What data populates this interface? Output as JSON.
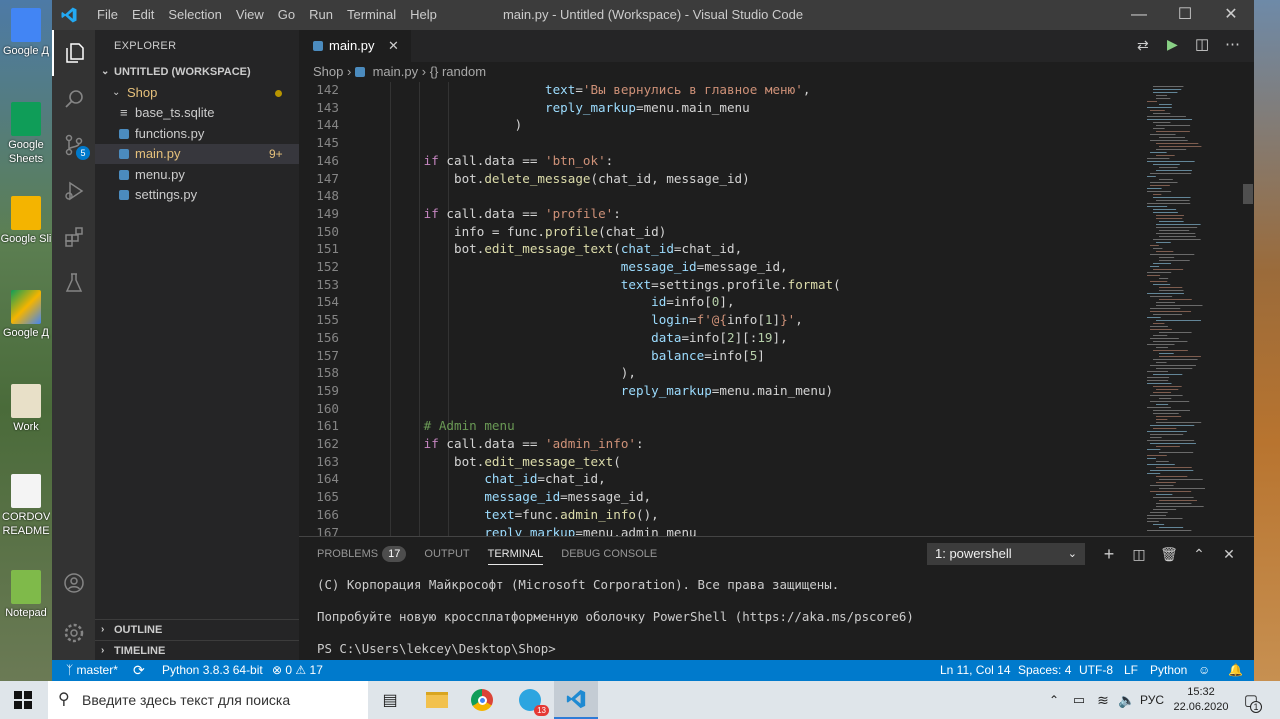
{
  "window": {
    "title": "main.py - Untitled (Workspace) - Visual Studio Code"
  },
  "menu": [
    "File",
    "Edit",
    "Selection",
    "View",
    "Go",
    "Run",
    "Terminal",
    "Help"
  ],
  "desktop_icons": [
    {
      "label": "Google Д"
    },
    {
      "label": "Google Sheets"
    },
    {
      "label": "Google Sli"
    },
    {
      "label": "Google Д"
    },
    {
      "label": "Work"
    },
    {
      "label": "CORDOV README"
    },
    {
      "label": "Notepad"
    }
  ],
  "activity": {
    "scm_badge": "5"
  },
  "sidebar": {
    "header": "EXPLORER",
    "workspace": "UNTITLED (WORKSPACE)",
    "folder": "Shop",
    "files": [
      {
        "name": "base_ts.sqlite",
        "color": "#cccccc",
        "badge": ""
      },
      {
        "name": "functions.py",
        "color": "#cccccc",
        "badge": ""
      },
      {
        "name": "main.py",
        "color": "#e5c07b",
        "badge": "9+"
      },
      {
        "name": "menu.py",
        "color": "#cccccc",
        "badge": ""
      },
      {
        "name": "settings.py",
        "color": "#cccccc",
        "badge": ""
      }
    ],
    "outline": "OUTLINE",
    "timeline": "TIMELINE"
  },
  "tab": {
    "name": "main.py"
  },
  "breadcrumb": {
    "folder": "Shop",
    "file": "main.py",
    "symbol": "{} random"
  },
  "code_lines": [
    {
      "n": "142",
      "html": "                        <span class=\"p\">text</span>=<span class=\"s\">'Вы вернулись в главное меню'</span>,"
    },
    {
      "n": "143",
      "html": "                        <span class=\"p\">reply_markup</span>=menu.main_menu"
    },
    {
      "n": "144",
      "html": "                    )"
    },
    {
      "n": "145",
      "html": ""
    },
    {
      "n": "146",
      "html": "        <span class=\"k\">if</span> call.data == <span class=\"s\">'btn_ok'</span>:"
    },
    {
      "n": "147",
      "html": "            bot.<span class=\"f\">delete_message</span>(chat_id, message_id)"
    },
    {
      "n": "148",
      "html": ""
    },
    {
      "n": "149",
      "html": "        <span class=\"k\">if</span> call.data == <span class=\"s\">'profile'</span>:"
    },
    {
      "n": "150",
      "html": "            info = func.<span class=\"f\">profile</span>(chat_id)"
    },
    {
      "n": "151",
      "html": "            bot.<span class=\"f\">edit_message_text</span>(<span class=\"p\">chat_id</span>=chat_id,"
    },
    {
      "n": "152",
      "html": "                                  <span class=\"p\">message_id</span>=message_id,"
    },
    {
      "n": "153",
      "html": "                                  <span class=\"p\">text</span>=settings.profile.<span class=\"f\">format</span>("
    },
    {
      "n": "154",
      "html": "                                      <span class=\"p\">id</span>=info[<span class=\"n\">0</span>],"
    },
    {
      "n": "155",
      "html": "                                      <span class=\"p\">login</span>=<span class=\"s\">f'@{</span>info[<span class=\"n\">1</span>]<span class=\"s\">}'</span>,"
    },
    {
      "n": "156",
      "html": "                                      <span class=\"p\">data</span>=info[<span class=\"n\">2</span>][:<span class=\"n\">19</span>],"
    },
    {
      "n": "157",
      "html": "                                      <span class=\"p\">balance</span>=info[<span class=\"n\">5</span>]"
    },
    {
      "n": "158",
      "html": "                                  ),"
    },
    {
      "n": "159",
      "html": "                                  <span class=\"p\">reply_markup</span>=menu.main_menu)"
    },
    {
      "n": "160",
      "html": ""
    },
    {
      "n": "161",
      "html": "        <span class=\"c\"># Admin menu</span>"
    },
    {
      "n": "162",
      "html": "        <span class=\"k\">if</span> call.data == <span class=\"s\">'admin_info'</span>:"
    },
    {
      "n": "163",
      "html": "            bot.<span class=\"f\">edit_message_text</span>("
    },
    {
      "n": "164",
      "html": "                <span class=\"p\">chat_id</span>=chat_id,"
    },
    {
      "n": "165",
      "html": "                <span class=\"p\">message_id</span>=message_id,"
    },
    {
      "n": "166",
      "html": "                <span class=\"p\">text</span>=func.<span class=\"f\">admin_info</span>(),"
    },
    {
      "n": "167",
      "html": "                <span class=\"p\">reply_markup</span>=menu.admin_menu"
    }
  ],
  "panel": {
    "tabs": [
      {
        "label": "PROBLEMS",
        "badge": "17"
      },
      {
        "label": "OUTPUT",
        "badge": ""
      },
      {
        "label": "TERMINAL",
        "badge": ""
      },
      {
        "label": "DEBUG CONSOLE",
        "badge": ""
      }
    ],
    "active_tab": "TERMINAL",
    "terminal_select": "1: powershell",
    "terminal_lines": [
      "(C) Корпорация Майкрософт (Microsoft Corporation). Все права защищены.",
      "",
      "Попробуйте новую кроссплатформенную оболочку PowerShell (https://aka.ms/pscore6)",
      "",
      "PS C:\\Users\\lekcey\\Desktop\\Shop>"
    ]
  },
  "status": {
    "branch": "master*",
    "python": "Python 3.8.3 64-bit",
    "errors": "0",
    "warnings": "17",
    "position": "Ln 11, Col 14",
    "spaces": "Spaces: 4",
    "encoding": "UTF-8",
    "eol": "LF",
    "language": "Python"
  },
  "taskbar": {
    "search_placeholder": "Введите здесь текст для поиска",
    "telegram_badge": "13",
    "lang": "РУС",
    "time": "15:32",
    "date": "22.06.2020",
    "notif_count": "1"
  },
  "colors": {
    "accent": "#007acc",
    "titlebar": "#3c3c3c",
    "editor_bg": "#1e1e1e",
    "sidebar_bg": "#252526"
  }
}
